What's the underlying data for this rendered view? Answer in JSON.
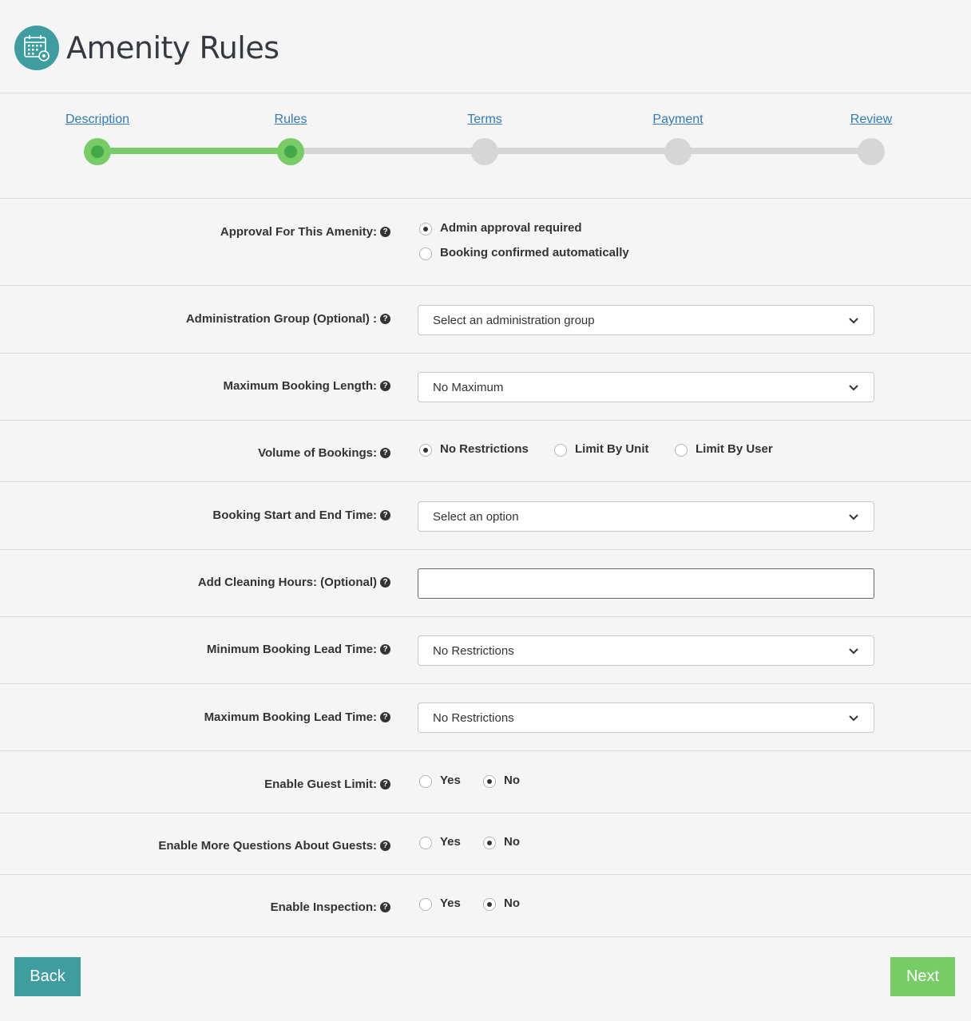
{
  "header": {
    "title": "Amenity Rules",
    "icon": "calendar-gear-icon",
    "accent_color": "#3f9c9f"
  },
  "stepper": {
    "steps": [
      "Description",
      "Rules",
      "Terms",
      "Payment",
      "Review"
    ],
    "completed_color": "#77cc66",
    "current_step": "Rules"
  },
  "fields": {
    "approval": {
      "label": "Approval For This Amenity:",
      "options": [
        "Admin approval required",
        "Booking confirmed automatically"
      ],
      "selected": "Admin approval required"
    },
    "admin_group": {
      "label": "Administration Group (Optional) :",
      "value": "Select an administration group"
    },
    "max_booking_length": {
      "label": "Maximum Booking Length:",
      "value": "No Maximum"
    },
    "volume": {
      "label": "Volume of Bookings:",
      "options": [
        "No Restrictions",
        "Limit By Unit",
        "Limit By User"
      ],
      "selected": "No Restrictions"
    },
    "start_end_time": {
      "label": "Booking Start and End Time:",
      "value": "Select an option"
    },
    "cleaning_hours": {
      "label": "Add Cleaning Hours: (Optional)",
      "value": ""
    },
    "min_lead_time": {
      "label": "Minimum Booking Lead Time:",
      "value": "No Restrictions"
    },
    "max_lead_time": {
      "label": "Maximum Booking Lead Time:",
      "value": "No Restrictions"
    },
    "guest_limit": {
      "label": "Enable Guest Limit:",
      "options": [
        "Yes",
        "No"
      ],
      "selected": "No"
    },
    "more_questions": {
      "label": "Enable More Questions About Guests:",
      "options": [
        "Yes",
        "No"
      ],
      "selected": "No"
    },
    "inspection": {
      "label": "Enable Inspection:",
      "options": [
        "Yes",
        "No"
      ],
      "selected": "No"
    }
  },
  "help_icon": "?",
  "buttons": {
    "back": "Back",
    "next": "Next"
  }
}
